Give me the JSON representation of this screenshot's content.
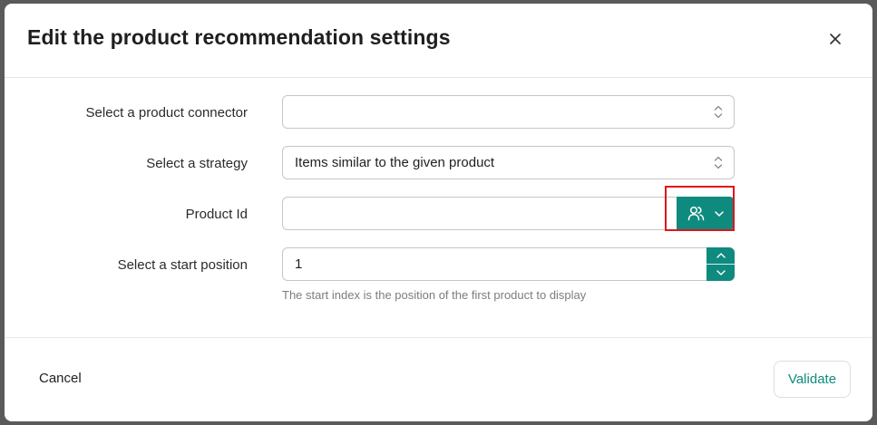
{
  "modal": {
    "title": "Edit the product recommendation settings",
    "close_icon": "close-icon"
  },
  "form": {
    "connector": {
      "label": "Select a product connector",
      "value": "",
      "icon": "sort-arrows-icon"
    },
    "strategy": {
      "label": "Select a strategy",
      "value": "Items similar to the given product",
      "icon": "sort-arrows-icon"
    },
    "product_id": {
      "label": "Product Id",
      "value": "",
      "button_icons": [
        "users-icon",
        "chevron-down-icon"
      ]
    },
    "start_position": {
      "label": "Select a start position",
      "value": "1",
      "help": "The start index is the position of the first product to display",
      "icons": [
        "chevron-up-icon",
        "chevron-down-icon"
      ]
    }
  },
  "footer": {
    "cancel_label": "Cancel",
    "validate_label": "Validate"
  },
  "colors": {
    "accent": "#0e8b7e",
    "highlight": "#e0141b"
  }
}
